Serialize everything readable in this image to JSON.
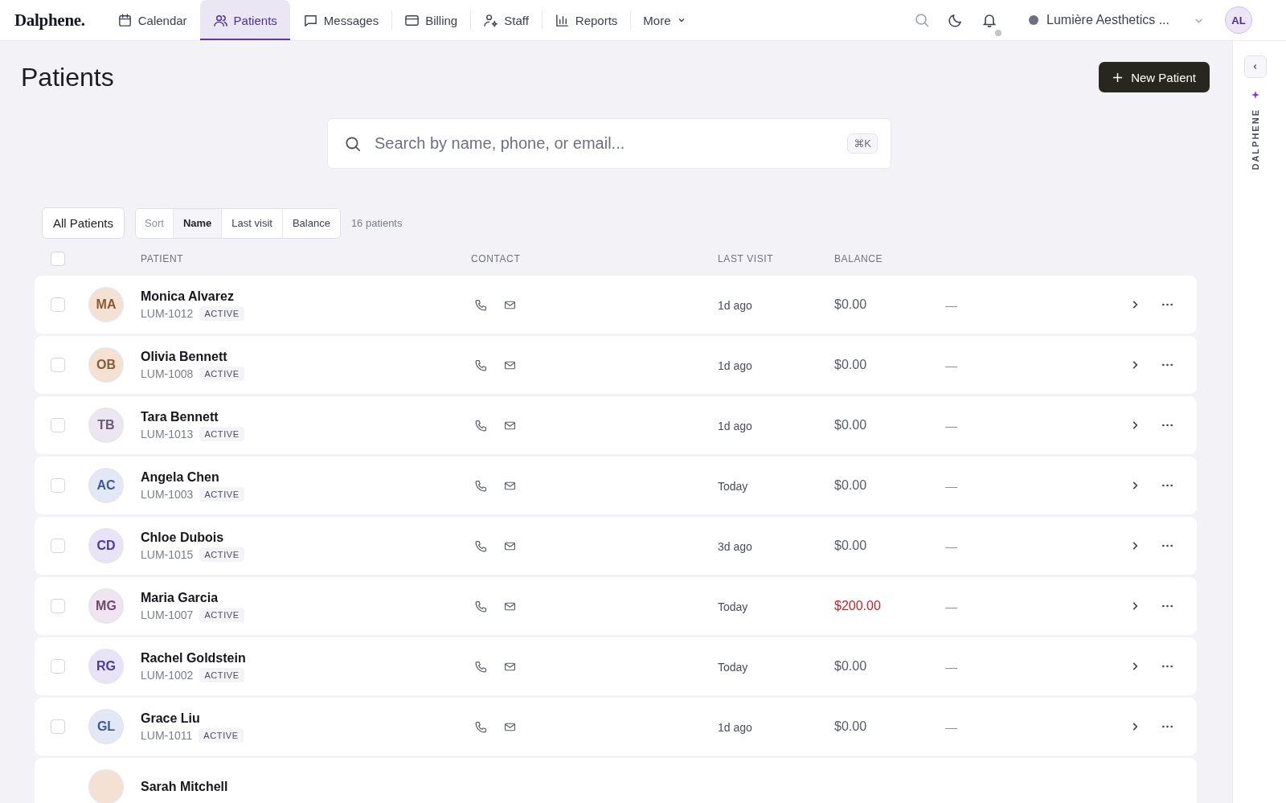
{
  "nav": {
    "logo": "Dalphene.",
    "items": [
      {
        "label": "Calendar",
        "selected": false
      },
      {
        "label": "Patients",
        "selected": true
      },
      {
        "label": "Messages",
        "selected": false
      },
      {
        "label": "Billing",
        "selected": false
      },
      {
        "label": "Staff",
        "selected": false
      },
      {
        "label": "Reports",
        "selected": false
      },
      {
        "label": "More",
        "selected": false
      }
    ],
    "org": "Lumière Aesthetics ...",
    "avatar": "AL"
  },
  "page": {
    "title": "Patients",
    "new_button": "New Patient"
  },
  "search": {
    "placeholder": "Search by name, phone, or email...",
    "shortcut": "⌘K"
  },
  "filter": {
    "label": "All Patients"
  },
  "sort": {
    "label": "Sort",
    "options": [
      {
        "label": "Name",
        "selected": true
      },
      {
        "label": "Last visit",
        "selected": false
      },
      {
        "label": "Balance",
        "selected": false
      }
    ]
  },
  "count": "16 patients",
  "select_all": {
    "checked": false
  },
  "columns": [
    "PATIENT",
    "CONTACT",
    "LAST VISIT",
    "BALANCE"
  ],
  "rows": [
    {
      "initials": "MA",
      "color": "#f4e1d2",
      "name": "Monica Alvarez",
      "id": "LUM-1012",
      "checked": false,
      "status": "ACTIVE",
      "last_visit": "1d ago",
      "balance": "$0.00",
      "owed": false,
      "column_6": "—"
    },
    {
      "initials": "OB",
      "color": "#f4e1d2",
      "name": "Olivia Bennett",
      "id": "LUM-1008",
      "checked": false,
      "status": "ACTIVE",
      "last_visit": "1d ago",
      "balance": "$0.00",
      "owed": false,
      "column_6": "—"
    },
    {
      "initials": "TB",
      "color": "#ece6f0",
      "name": "Tara Bennett",
      "id": "LUM-1013",
      "checked": false,
      "status": "ACTIVE",
      "last_visit": "1d ago",
      "balance": "$0.00",
      "owed": false,
      "column_6": "—"
    },
    {
      "initials": "AC",
      "color": "#e3e8f6",
      "name": "Angela Chen",
      "id": "LUM-1003",
      "checked": false,
      "status": "ACTIVE",
      "last_visit": "Today",
      "balance": "$0.00",
      "owed": false,
      "column_6": "—"
    },
    {
      "initials": "CD",
      "color": "#e8e3f7",
      "name": "Chloe Dubois",
      "id": "LUM-1015",
      "checked": false,
      "status": "ACTIVE",
      "last_visit": "3d ago",
      "balance": "$0.00",
      "owed": false,
      "column_6": "—"
    },
    {
      "initials": "MG",
      "color": "#efe4ef",
      "name": "Maria Garcia",
      "id": "LUM-1007",
      "checked": false,
      "status": "ACTIVE",
      "last_visit": "Today",
      "balance": "$200.00",
      "owed": true,
      "column_6": "—"
    },
    {
      "initials": "RG",
      "color": "#e8e3f7",
      "name": "Rachel Goldstein",
      "id": "LUM-1002",
      "checked": false,
      "status": "ACTIVE",
      "last_visit": "Today",
      "balance": "$0.00",
      "owed": false,
      "column_6": "—"
    },
    {
      "initials": "GL",
      "color": "#e3e8f6",
      "name": "Grace Liu",
      "id": "LUM-1011",
      "checked": false,
      "status": "ACTIVE",
      "last_visit": "1d ago",
      "balance": "$0.00",
      "owed": false,
      "column_6": "—"
    },
    {
      "color": "#f4e1d2",
      "name": "Sarah Mitchell"
    }
  ],
  "side": {
    "label": "DALPHENE"
  }
}
